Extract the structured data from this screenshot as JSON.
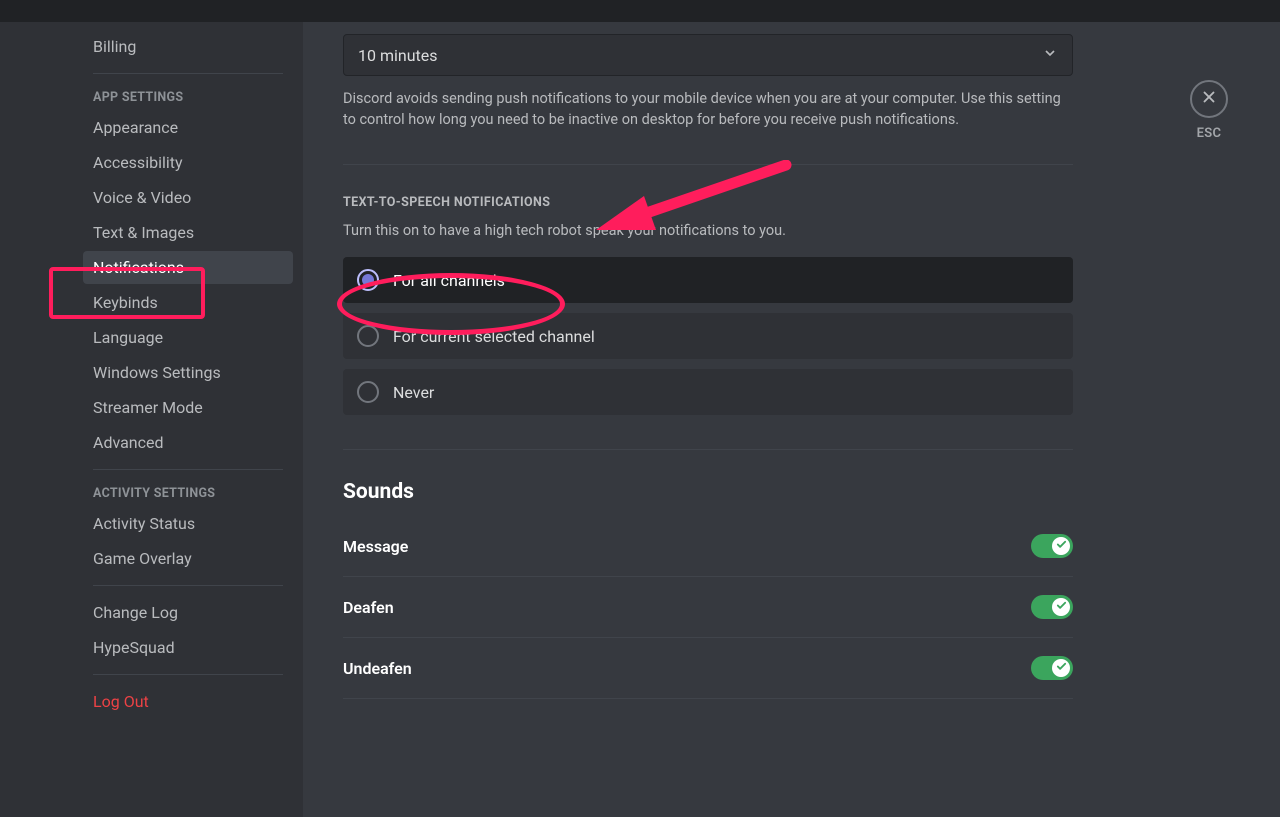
{
  "sidebar": {
    "items": [
      {
        "label": "Billing",
        "type": "item"
      },
      {
        "type": "sep"
      },
      {
        "label": "APP SETTINGS",
        "type": "header"
      },
      {
        "label": "Appearance",
        "type": "item"
      },
      {
        "label": "Accessibility",
        "type": "item"
      },
      {
        "label": "Voice & Video",
        "type": "item"
      },
      {
        "label": "Text & Images",
        "type": "item"
      },
      {
        "label": "Notifications",
        "type": "item",
        "active": true
      },
      {
        "label": "Keybinds",
        "type": "item"
      },
      {
        "label": "Language",
        "type": "item"
      },
      {
        "label": "Windows Settings",
        "type": "item"
      },
      {
        "label": "Streamer Mode",
        "type": "item"
      },
      {
        "label": "Advanced",
        "type": "item"
      },
      {
        "type": "sep"
      },
      {
        "label": "ACTIVITY SETTINGS",
        "type": "header"
      },
      {
        "label": "Activity Status",
        "type": "item"
      },
      {
        "label": "Game Overlay",
        "type": "item"
      },
      {
        "type": "sep"
      },
      {
        "label": "Change Log",
        "type": "item"
      },
      {
        "label": "HypeSquad",
        "type": "item"
      },
      {
        "type": "sep"
      },
      {
        "label": "Log Out",
        "type": "item",
        "logout": true
      }
    ]
  },
  "idle": {
    "selected": "10 minutes",
    "helper": "Discord avoids sending push notifications to your mobile device when you are at your computer. Use this setting to control how long you need to be inactive on desktop for before you receive push notifications."
  },
  "tts": {
    "header": "TEXT-TO-SPEECH NOTIFICATIONS",
    "helper": "Turn this on to have a high tech robot speak your notifications to you.",
    "options": [
      {
        "label": "For all channels",
        "selected": true
      },
      {
        "label": "For current selected channel",
        "selected": false
      },
      {
        "label": "Never",
        "selected": false
      }
    ]
  },
  "sounds": {
    "title": "Sounds",
    "rows": [
      {
        "label": "Message",
        "on": true
      },
      {
        "label": "Deafen",
        "on": true
      },
      {
        "label": "Undeafen",
        "on": true
      }
    ]
  },
  "close": {
    "esc": "ESC"
  }
}
